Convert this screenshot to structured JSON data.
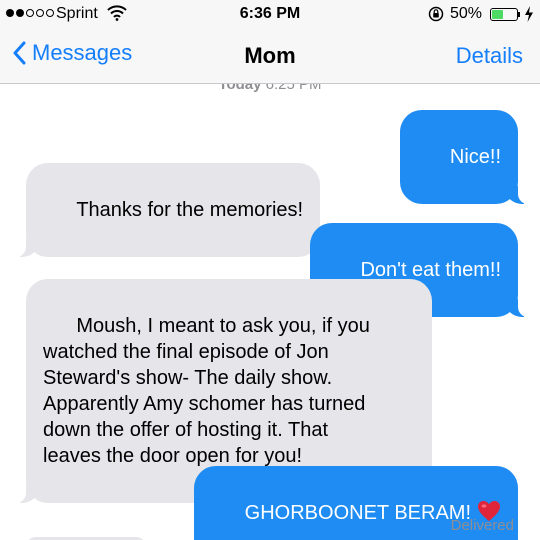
{
  "status_bar": {
    "carrier": "Sprint",
    "time": "6:36 PM",
    "battery_percent": "50%",
    "battery_level": 0.5,
    "signal_bars_filled": 2,
    "signal_bars_total": 5
  },
  "nav": {
    "back_label": "Messages",
    "title": "Mom",
    "details_label": "Details"
  },
  "conversation": {
    "timestamp_day": "Today",
    "timestamp_time": "6:25 PM",
    "messages": [
      {
        "direction": "outgoing",
        "text": "Nice!!"
      },
      {
        "direction": "incoming",
        "text": "Thanks for the memories!"
      },
      {
        "direction": "outgoing",
        "text": "Don't eat them!!"
      },
      {
        "direction": "incoming",
        "text": "Moush, I meant to ask you, if you\nwatched the final episode of Jon\nSteward's show- The daily show.\nApparently Amy schomer has turned\ndown the offer of hosting it. That\nleaves the door open for you!"
      },
      {
        "direction": "outgoing",
        "text": "GHORBOONET BERAM!",
        "emoji": "heart-icon"
      }
    ],
    "delivered_label": "Delivered"
  },
  "colors": {
    "accent": "#147efb",
    "outgoing_bubble": "#1e8cf3",
    "incoming_bubble": "#e5e5ea",
    "battery_fill": "#4cd964",
    "secondary_text": "#8e8e93"
  }
}
